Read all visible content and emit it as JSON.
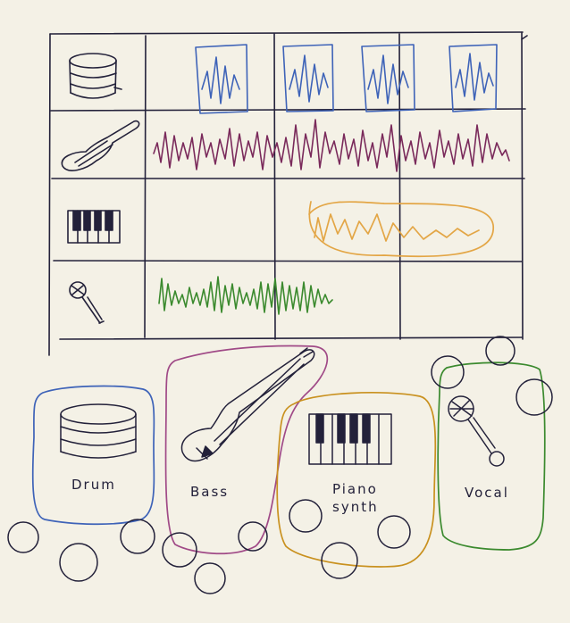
{
  "colors": {
    "paper": "#f4f1e6",
    "ink": "#23213a",
    "drum": "#3e63b8",
    "bass": "#7a2a5b",
    "piano_synth": "#e3a646",
    "vocal": "#3b8a2e",
    "piano_frame": "#c9911f",
    "vocal_frame": "#3b8a2e",
    "bass_frame": "#a04a87",
    "drum_frame": "#3e63b8"
  },
  "tracks": [
    {
      "name": "drum-track",
      "icon": "drum-icon"
    },
    {
      "name": "bass-track",
      "icon": "bass-guitar-icon"
    },
    {
      "name": "piano-synth-track",
      "icon": "piano-keys-icon"
    },
    {
      "name": "vocal-track",
      "icon": "microphone-icon"
    }
  ],
  "instruments": {
    "drum": {
      "label": "Drum",
      "icon": "drum-icon"
    },
    "bass": {
      "label": "Bass",
      "icon": "bass-guitar-icon"
    },
    "piano_synth": {
      "label_line1": "Piano",
      "label_line2": "synth",
      "icon": "piano-keys-icon"
    },
    "vocal": {
      "label": "Vocal",
      "icon": "microphone-icon"
    }
  }
}
